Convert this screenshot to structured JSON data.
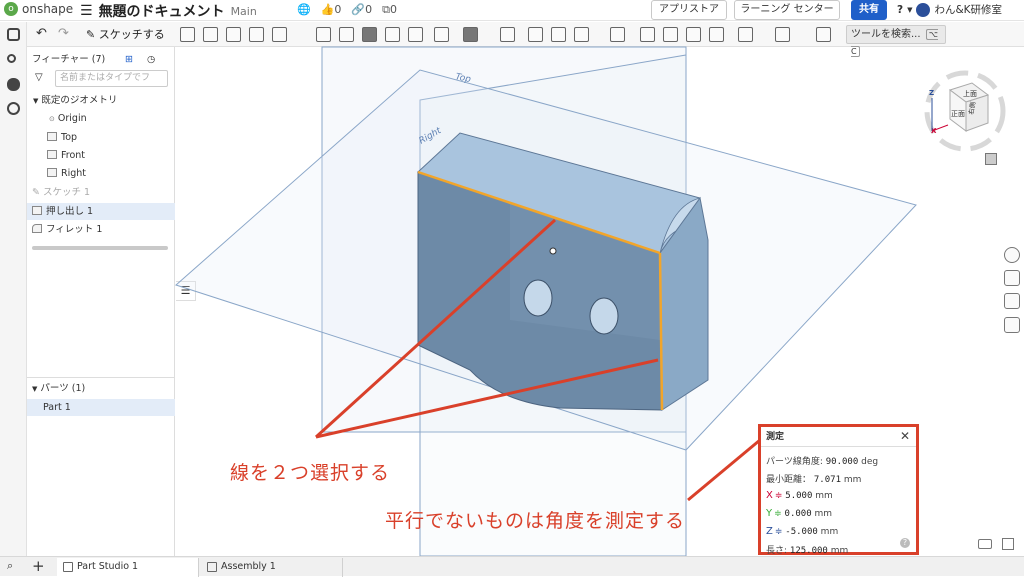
{
  "app": {
    "name": "onshape",
    "doc_title": "無題のドキュメント",
    "branch": "Main"
  },
  "topbar": {
    "likes": "0",
    "links": "0",
    "copies": "0",
    "app_store": "アプリストア",
    "learning": "ラーニング センター",
    "share": "共有",
    "help": "?",
    "user": "わん&K研修室"
  },
  "toolbar": {
    "sketch": "スケッチする",
    "search": "ツールを検索...",
    "search_shortcut": "⌥ C"
  },
  "features": {
    "header": "フィーチャー (7)",
    "filter_placeholder": "名前またはタイプでフ",
    "default_geometry": "既定のジオメトリ",
    "origin": "Origin",
    "planes": [
      "Top",
      "Front",
      "Right"
    ],
    "items": [
      "スケッチ 1",
      "押し出し 1",
      "フィレット 1"
    ]
  },
  "parts": {
    "header": "パーツ (1)",
    "items": [
      "Part 1"
    ]
  },
  "viewport": {
    "plane_top": "Top",
    "plane_right": "Right"
  },
  "viewcube": {
    "top": "上面",
    "front": "正面",
    "right": "右側",
    "axis_z": "Z",
    "axis_x": "X"
  },
  "measure": {
    "title": "測定",
    "angle_label": "パーツ線角度:",
    "angle_value": "90.000",
    "angle_unit": "deg",
    "min_label": "最小距離：",
    "min_value": "7.071",
    "min_unit": "mm",
    "x_label": "X",
    "x_value": "5.000",
    "x_unit": "mm",
    "y_label": "Y",
    "y_value": "0.000",
    "y_unit": "mm",
    "z_label": "Z",
    "z_value": "-5.000",
    "z_unit": "mm",
    "len_label": "長さ:",
    "len_value": "125.000",
    "len_unit": "mm"
  },
  "tabs": [
    "Part Studio 1",
    "Assembly 1"
  ],
  "annotations": {
    "select_two": "線を２つ選択する",
    "measure_angle": "平行でないものは角度を測定する"
  },
  "colors": {
    "accent": "#d9402a",
    "share": "#1f5fc9",
    "part": "#7d9cba",
    "edge": "#f2a52a"
  }
}
